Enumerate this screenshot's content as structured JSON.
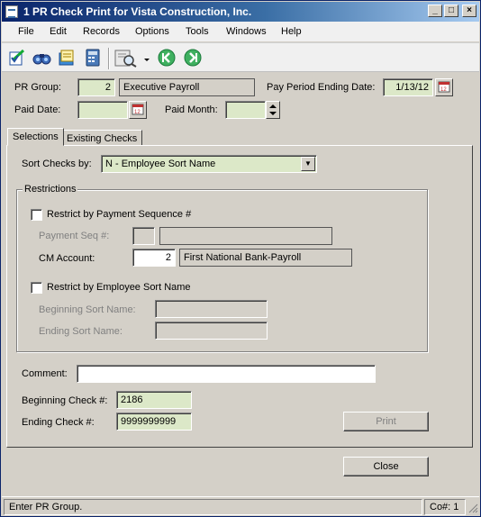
{
  "window": {
    "title": "1 PR Check Print for Vista Construction, Inc.",
    "minimize": "_",
    "maximize": "□",
    "close": "×"
  },
  "menu": [
    "File",
    "Edit",
    "Records",
    "Options",
    "Tools",
    "Windows",
    "Help"
  ],
  "toolbar": {
    "icons": [
      "edit-form-icon",
      "binoculars-icon",
      "notes-icon",
      "calculator-icon",
      "print-preview-icon",
      "dropdown-arrow-icon",
      "first-record-icon",
      "next-record-icon"
    ]
  },
  "header": {
    "pr_group_label": "PR Group:",
    "pr_group_value": "2",
    "pr_group_desc": "Executive Payroll",
    "pay_period_label": "Pay Period Ending Date:",
    "pay_period_value": "1/13/12",
    "paid_date_label": "Paid Date:",
    "paid_date_value": "",
    "paid_month_label": "Paid Month:",
    "paid_month_value": ""
  },
  "tabs": [
    "Selections",
    "Existing Checks"
  ],
  "selections": {
    "sort_label": "Sort Checks by:",
    "sort_value": "N - Employee Sort Name",
    "restrictions_label": "Restrictions",
    "restrict_payment_label": "Restrict by Payment Sequence #",
    "payment_seq_label": "Payment Seq #:",
    "payment_seq_value": "",
    "payment_seq_desc": "",
    "cm_account_label": "CM Account:",
    "cm_account_value": "2",
    "cm_account_desc": "First National Bank-Payroll",
    "restrict_employee_label": "Restrict by Employee Sort Name",
    "beginning_sort_label": "Beginning Sort Name:",
    "beginning_sort_value": "",
    "ending_sort_label": "Ending Sort Name:",
    "ending_sort_value": "",
    "comment_label": "Comment:",
    "comment_value": "",
    "beginning_check_label": "Beginning Check #:",
    "beginning_check_value": "2186",
    "ending_check_label": "Ending Check #:",
    "ending_check_value": "9999999999",
    "print_label": "Print"
  },
  "close_label": "Close",
  "status": {
    "message": "Enter PR Group.",
    "company": "Co#: 1"
  },
  "colors": {
    "required_field": "#dce8c8",
    "title_bar": "#0a246a"
  }
}
